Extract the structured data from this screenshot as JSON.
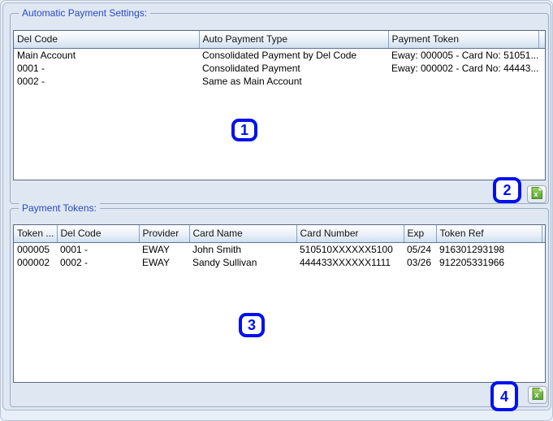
{
  "colors": {
    "annotation_blue": "#0010ee",
    "legend_blue": "#2b49c6",
    "excel_green": "#57a234",
    "panel_background": "#dfe7f2",
    "header_gradient_top": "#feffff",
    "header_gradient_bottom": "#cfdfef"
  },
  "panel1": {
    "legend": "Automatic Payment Settings:",
    "columns": [
      "Del Code",
      "Auto Payment Type",
      "Payment Token"
    ],
    "rows": [
      [
        "Main Account",
        "Consolidated Payment by Del Code",
        "Eway: 000005 - Card No: 51051..."
      ],
      [
        "0001 -",
        "Consolidated Payment",
        "Eway: 000002 - Card No: 44443..."
      ],
      [
        "0002 -",
        "Same as Main Account",
        ""
      ]
    ],
    "export_icon": "excel-export-icon"
  },
  "panel2": {
    "legend": "Payment Tokens:",
    "columns": [
      "Token ...",
      "Del Code",
      "Provider",
      "Card Name",
      "Card Number",
      "Exp",
      "Token Ref"
    ],
    "rows": [
      [
        "000005",
        "0001 -",
        "EWAY",
        "John Smith",
        "510510XXXXXX5100",
        "05/24",
        "916301293198"
      ],
      [
        "000002",
        "0002 -",
        "EWAY",
        "Sandy Sullivan",
        "444433XXXXXX1111",
        "03/26",
        "912205331966"
      ]
    ],
    "export_icon": "excel-export-icon"
  },
  "annotations": [
    "1",
    "2",
    "3",
    "4"
  ]
}
